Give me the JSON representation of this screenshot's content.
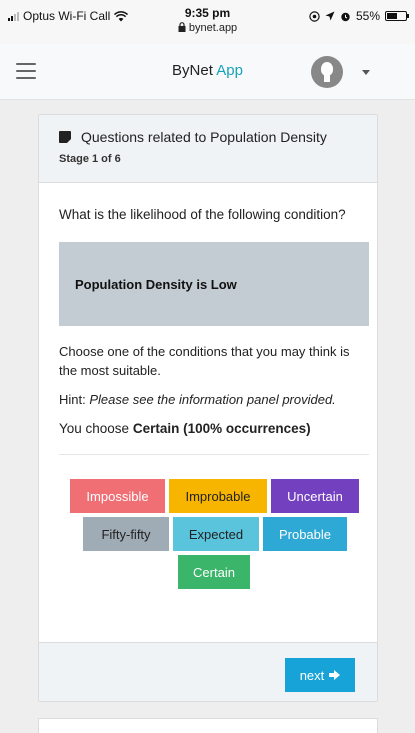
{
  "status_bar": {
    "carrier": "Optus Wi-Fi Call",
    "time": "9:35 pm",
    "url": "bynet.app",
    "battery": "55%",
    "battery_level": 0.55
  },
  "navbar": {
    "brand_main": "ByNet",
    "brand_accent": "App"
  },
  "card": {
    "title": "Questions related to Population Density",
    "stage": "Stage 1 of 6",
    "question": "What is the likelihood of the following condition?",
    "condition": "Population Density is Low",
    "instruction": "Choose one of the conditions that you may think is the most suitable.",
    "hint_label": "Hint:",
    "hint_text": "Please see the information panel provided.",
    "choice_prefix": "You choose",
    "choice_value": "Certain (100% occurrences)",
    "next_label": "next"
  },
  "options": [
    {
      "label": "Impossible",
      "color": "#f06f74"
    },
    {
      "label": "Improbable",
      "color": "#f7b500"
    },
    {
      "label": "Uncertain",
      "color": "#7340bf"
    },
    {
      "label": "Fifty-fifty",
      "color": "#a0acb5"
    },
    {
      "label": "Expected",
      "color": "#5bc4dd"
    },
    {
      "label": "Probable",
      "color": "#2ea8d5"
    },
    {
      "label": "Certain",
      "color": "#3bb56a"
    }
  ],
  "colors": {
    "accent": "#17a2d8",
    "condition_bg": "#c3ccd3"
  }
}
